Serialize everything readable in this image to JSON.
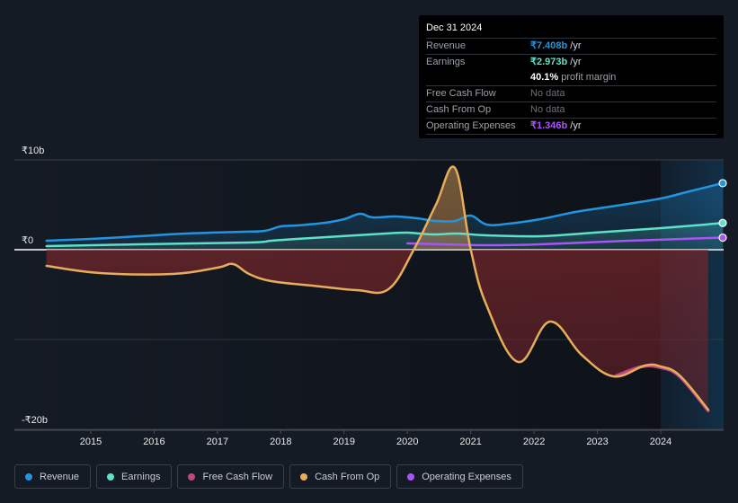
{
  "tooltip": {
    "date": "Dec 31 2024",
    "rows": [
      {
        "label": "Revenue",
        "value": "₹7.408b",
        "unit": " /yr",
        "color": "#2394df"
      },
      {
        "label": "Earnings",
        "value": "₹2.973b",
        "unit": " /yr",
        "color": "#5ee0c9"
      },
      {
        "label": "",
        "value": "40.1%",
        "unit": " profit margin",
        "color": "#ffffff"
      },
      {
        "label": "Free Cash Flow",
        "value": "No data",
        "unit": "",
        "color": "#6b7079"
      },
      {
        "label": "Cash From Op",
        "value": "No data",
        "unit": "",
        "color": "#6b7079"
      },
      {
        "label": "Operating Expenses",
        "value": "₹1.346b",
        "unit": " /yr",
        "color": "#a855f7"
      }
    ]
  },
  "legend": [
    {
      "label": "Revenue",
      "color": "#2394df"
    },
    {
      "label": "Earnings",
      "color": "#5ee0c9"
    },
    {
      "label": "Free Cash Flow",
      "color": "#c2477f"
    },
    {
      "label": "Cash From Op",
      "color": "#e8ad5a"
    },
    {
      "label": "Operating Expenses",
      "color": "#a855f7"
    }
  ],
  "chart_data": {
    "type": "line",
    "title": "",
    "xlabel": "",
    "ylabel": "",
    "currency_unit": "₹ billions",
    "ylim": [
      -20,
      10
    ],
    "xlim": [
      2014.3,
      2025.0
    ],
    "y_ticks": [
      {
        "value": 10,
        "label": "₹10b"
      },
      {
        "value": 0,
        "label": "₹0"
      },
      {
        "value": -20,
        "label": "-₹20b"
      }
    ],
    "x_ticks": [
      {
        "value": 2015,
        "label": "2015"
      },
      {
        "value": 2016,
        "label": "2016"
      },
      {
        "value": 2017,
        "label": "2017"
      },
      {
        "value": 2018,
        "label": "2018"
      },
      {
        "value": 2019,
        "label": "2019"
      },
      {
        "value": 2020,
        "label": "2020"
      },
      {
        "value": 2021,
        "label": "2021"
      },
      {
        "value": 2022,
        "label": "2022"
      },
      {
        "value": 2023,
        "label": "2023"
      },
      {
        "value": 2024,
        "label": "2024"
      }
    ],
    "grid": true,
    "legend_position": "bottom",
    "highlight_from": 2024.0,
    "series": [
      {
        "name": "Revenue",
        "color": "#2394df",
        "points": [
          [
            2014.3,
            1.0
          ],
          [
            2015.0,
            1.2
          ],
          [
            2015.75,
            1.5
          ],
          [
            2016.5,
            1.8
          ],
          [
            2017.4,
            2.0
          ],
          [
            2017.75,
            2.1
          ],
          [
            2018.0,
            2.6
          ],
          [
            2018.25,
            2.7
          ],
          [
            2018.7,
            3.0
          ],
          [
            2019.0,
            3.4
          ],
          [
            2019.25,
            4.0
          ],
          [
            2019.45,
            3.6
          ],
          [
            2019.8,
            3.7
          ],
          [
            2020.15,
            3.5
          ],
          [
            2020.45,
            3.2
          ],
          [
            2020.75,
            3.2
          ],
          [
            2021.0,
            3.8
          ],
          [
            2021.25,
            2.8
          ],
          [
            2021.6,
            2.9
          ],
          [
            2022.1,
            3.4
          ],
          [
            2022.65,
            4.2
          ],
          [
            2023.3,
            4.9
          ],
          [
            2024.0,
            5.7
          ],
          [
            2024.4,
            6.4
          ],
          [
            2024.98,
            7.408
          ]
        ]
      },
      {
        "name": "Earnings",
        "color": "#5ee0c9",
        "points": [
          [
            2014.3,
            0.4
          ],
          [
            2015.75,
            0.6
          ],
          [
            2017.5,
            0.8
          ],
          [
            2017.85,
            1.0
          ],
          [
            2018.25,
            1.2
          ],
          [
            2018.95,
            1.5
          ],
          [
            2019.65,
            1.8
          ],
          [
            2020.0,
            1.9
          ],
          [
            2020.4,
            1.7
          ],
          [
            2020.8,
            1.8
          ],
          [
            2021.25,
            1.6
          ],
          [
            2022.1,
            1.5
          ],
          [
            2022.95,
            1.9
          ],
          [
            2024.0,
            2.4
          ],
          [
            2024.98,
            2.973
          ]
        ]
      },
      {
        "name": "Operating Expenses",
        "color": "#a855f7",
        "points": [
          [
            2020.0,
            0.7
          ],
          [
            2020.6,
            0.6
          ],
          [
            2021.25,
            0.5
          ],
          [
            2022.1,
            0.6
          ],
          [
            2023.5,
            1.0
          ],
          [
            2024.98,
            1.346
          ]
        ]
      },
      {
        "name": "Free Cash Flow",
        "color": "#c2477f",
        "points": [
          [
            2023.3,
            -13.9
          ],
          [
            2023.7,
            -12.9
          ],
          [
            2024.0,
            -13.0
          ],
          [
            2024.3,
            -14.0
          ],
          [
            2024.75,
            -17.8
          ]
        ]
      },
      {
        "name": "Cash From Op",
        "color": "#e8ad5a",
        "points": [
          [
            2014.3,
            -1.8
          ],
          [
            2015.15,
            -2.6
          ],
          [
            2016.3,
            -2.7
          ],
          [
            2017.0,
            -2.0
          ],
          [
            2017.25,
            -1.6
          ],
          [
            2017.5,
            -2.7
          ],
          [
            2017.85,
            -3.5
          ],
          [
            2018.5,
            -4.0
          ],
          [
            2019.2,
            -4.5
          ],
          [
            2019.7,
            -4.4
          ],
          [
            2020.1,
            0.0
          ],
          [
            2020.45,
            5.0
          ],
          [
            2020.75,
            9.1
          ],
          [
            2021.0,
            0.0
          ],
          [
            2021.25,
            -6.2
          ],
          [
            2021.75,
            -12.5
          ],
          [
            2022.25,
            -8.0
          ],
          [
            2022.75,
            -11.7
          ],
          [
            2023.25,
            -14.1
          ],
          [
            2023.75,
            -12.9
          ],
          [
            2024.0,
            -13.0
          ],
          [
            2024.3,
            -14.0
          ],
          [
            2024.75,
            -17.8
          ]
        ]
      }
    ]
  }
}
